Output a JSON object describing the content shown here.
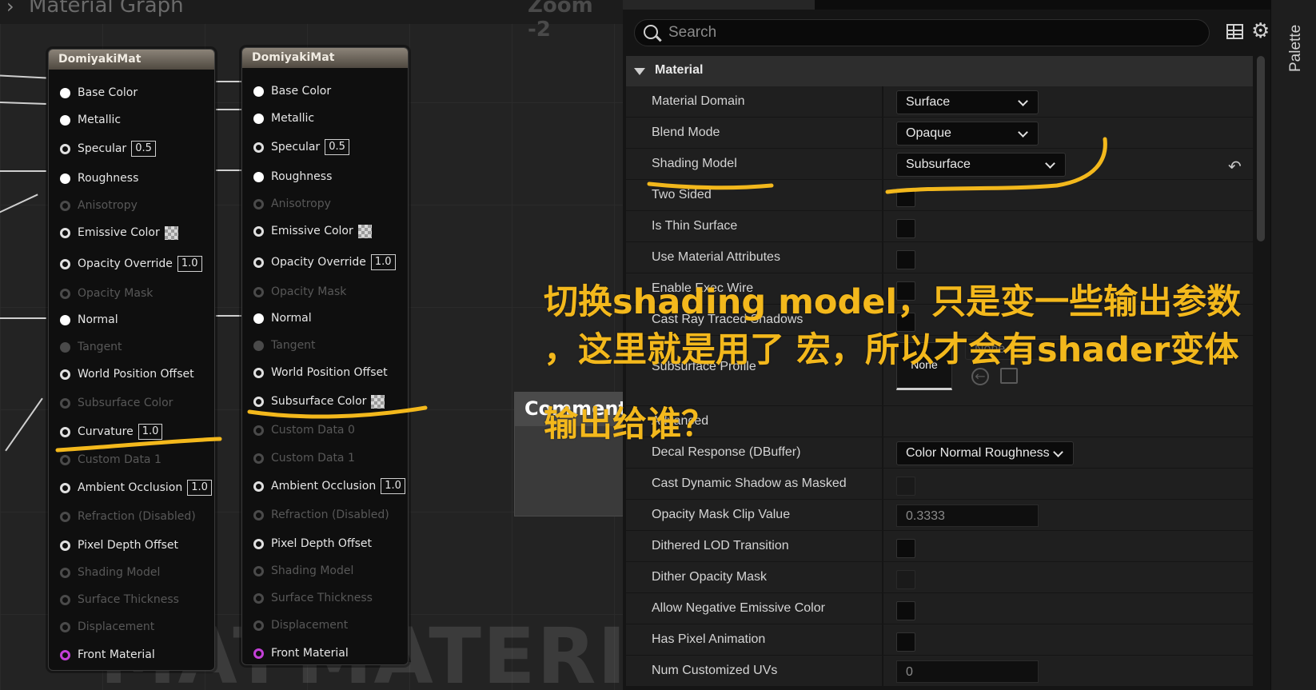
{
  "graph": {
    "title": "Material Graph",
    "zoom": "Zoom -2",
    "watermark_left": "MAT",
    "watermark_right": "MATERIAL",
    "node1": {
      "title": "DomiyakiMat",
      "pins": [
        {
          "label": "Base Color",
          "kind": "filled",
          "value": ""
        },
        {
          "label": "Metallic",
          "kind": "filled",
          "value": ""
        },
        {
          "label": "Specular",
          "kind": "hollow",
          "value": "0.5"
        },
        {
          "label": "Roughness",
          "kind": "filled",
          "value": ""
        },
        {
          "label": "Anisotropy",
          "kind": "disabled",
          "value": ""
        },
        {
          "label": "Emissive Color",
          "kind": "hollow",
          "value": "checker"
        },
        {
          "label": "Opacity Override",
          "kind": "hollow",
          "value": "1.0"
        },
        {
          "label": "Opacity Mask",
          "kind": "disabled",
          "value": ""
        },
        {
          "label": "Normal",
          "kind": "filled",
          "value": ""
        },
        {
          "label": "Tangent",
          "kind": "disabled-filled",
          "value": ""
        },
        {
          "label": "World Position Offset",
          "kind": "hollow",
          "value": ""
        },
        {
          "label": "Subsurface Color",
          "kind": "disabled",
          "value": ""
        },
        {
          "label": "Curvature",
          "kind": "hollow",
          "value": "1.0"
        },
        {
          "label": "Custom Data 1",
          "kind": "disabled",
          "value": ""
        },
        {
          "label": "Ambient Occlusion",
          "kind": "hollow",
          "value": "1.0"
        },
        {
          "label": "Refraction (Disabled)",
          "kind": "disabled",
          "value": ""
        },
        {
          "label": "Pixel Depth Offset",
          "kind": "hollow",
          "value": ""
        },
        {
          "label": "Shading Model",
          "kind": "disabled",
          "value": ""
        },
        {
          "label": "Surface Thickness",
          "kind": "disabled",
          "value": ""
        },
        {
          "label": "Displacement",
          "kind": "disabled",
          "value": ""
        },
        {
          "label": "Front Material",
          "kind": "purple",
          "value": ""
        }
      ]
    },
    "node2": {
      "title": "DomiyakiMat",
      "pins": [
        {
          "label": "Base Color",
          "kind": "filled",
          "value": ""
        },
        {
          "label": "Metallic",
          "kind": "filled",
          "value": ""
        },
        {
          "label": "Specular",
          "kind": "hollow",
          "value": "0.5"
        },
        {
          "label": "Roughness",
          "kind": "filled",
          "value": ""
        },
        {
          "label": "Anisotropy",
          "kind": "disabled",
          "value": ""
        },
        {
          "label": "Emissive Color",
          "kind": "hollow",
          "value": "checker"
        },
        {
          "label": "Opacity Override",
          "kind": "hollow",
          "value": "1.0"
        },
        {
          "label": "Opacity Mask",
          "kind": "disabled",
          "value": ""
        },
        {
          "label": "Normal",
          "kind": "filled",
          "value": ""
        },
        {
          "label": "Tangent",
          "kind": "disabled-filled",
          "value": ""
        },
        {
          "label": "World Position Offset",
          "kind": "hollow",
          "value": ""
        },
        {
          "label": "Subsurface Color",
          "kind": "hollow",
          "value": "checker"
        },
        {
          "label": "Custom Data 0",
          "kind": "disabled",
          "value": ""
        },
        {
          "label": "Custom Data 1",
          "kind": "disabled",
          "value": ""
        },
        {
          "label": "Ambient Occlusion",
          "kind": "hollow",
          "value": "1.0"
        },
        {
          "label": "Refraction (Disabled)",
          "kind": "disabled",
          "value": ""
        },
        {
          "label": "Pixel Depth Offset",
          "kind": "hollow",
          "value": ""
        },
        {
          "label": "Shading Model",
          "kind": "disabled",
          "value": ""
        },
        {
          "label": "Surface Thickness",
          "kind": "disabled",
          "value": ""
        },
        {
          "label": "Displacement",
          "kind": "disabled",
          "value": ""
        },
        {
          "label": "Front Material",
          "kind": "purple",
          "value": ""
        }
      ]
    },
    "comment": "Comment"
  },
  "details": {
    "search_placeholder": "Search",
    "category": "Material",
    "rows": [
      {
        "label": "Material Domain",
        "type": "combo",
        "value": "Surface"
      },
      {
        "label": "Blend Mode",
        "type": "combo",
        "value": "Opaque"
      },
      {
        "label": "Shading Model",
        "type": "combo",
        "value": "Subsurface"
      },
      {
        "label": "Two Sided",
        "type": "check",
        "value": ""
      },
      {
        "label": "Is Thin Surface",
        "type": "check",
        "value": ""
      },
      {
        "label": "Use Material Attributes",
        "type": "check",
        "value": ""
      },
      {
        "label": "Enable Exec Wire",
        "type": "check",
        "value": ""
      },
      {
        "label": "Cast Ray Traced Shadows",
        "type": "check",
        "value": ""
      },
      {
        "label": "Subsurface Profile",
        "type": "profile",
        "value": "None",
        "combo": "None"
      },
      {
        "label": "Advanced",
        "type": "label",
        "value": ""
      },
      {
        "label": "Decal Response (DBuffer)",
        "type": "combo",
        "value": "Color Normal Roughness"
      },
      {
        "label": "Cast Dynamic Shadow as Masked",
        "type": "check-dis",
        "value": ""
      },
      {
        "label": "Opacity Mask Clip Value",
        "type": "number",
        "value": "0.3333"
      },
      {
        "label": "Dithered LOD Transition",
        "type": "check",
        "value": ""
      },
      {
        "label": "Dither Opacity Mask",
        "type": "check-dis",
        "value": ""
      },
      {
        "label": "Allow Negative Emissive Color",
        "type": "check",
        "value": ""
      },
      {
        "label": "Has Pixel Animation",
        "type": "check",
        "value": ""
      },
      {
        "label": "Num Customized UVs",
        "type": "number",
        "value": "0"
      }
    ]
  },
  "palette": {
    "label": "Palette"
  },
  "annotations": {
    "line1": "切换shading model，只是变一些输出参数",
    "line2": "，这里就是用了 宏，所以才会有shader变体",
    "line3": "输出给谁？",
    "color": "#f3b81c"
  }
}
